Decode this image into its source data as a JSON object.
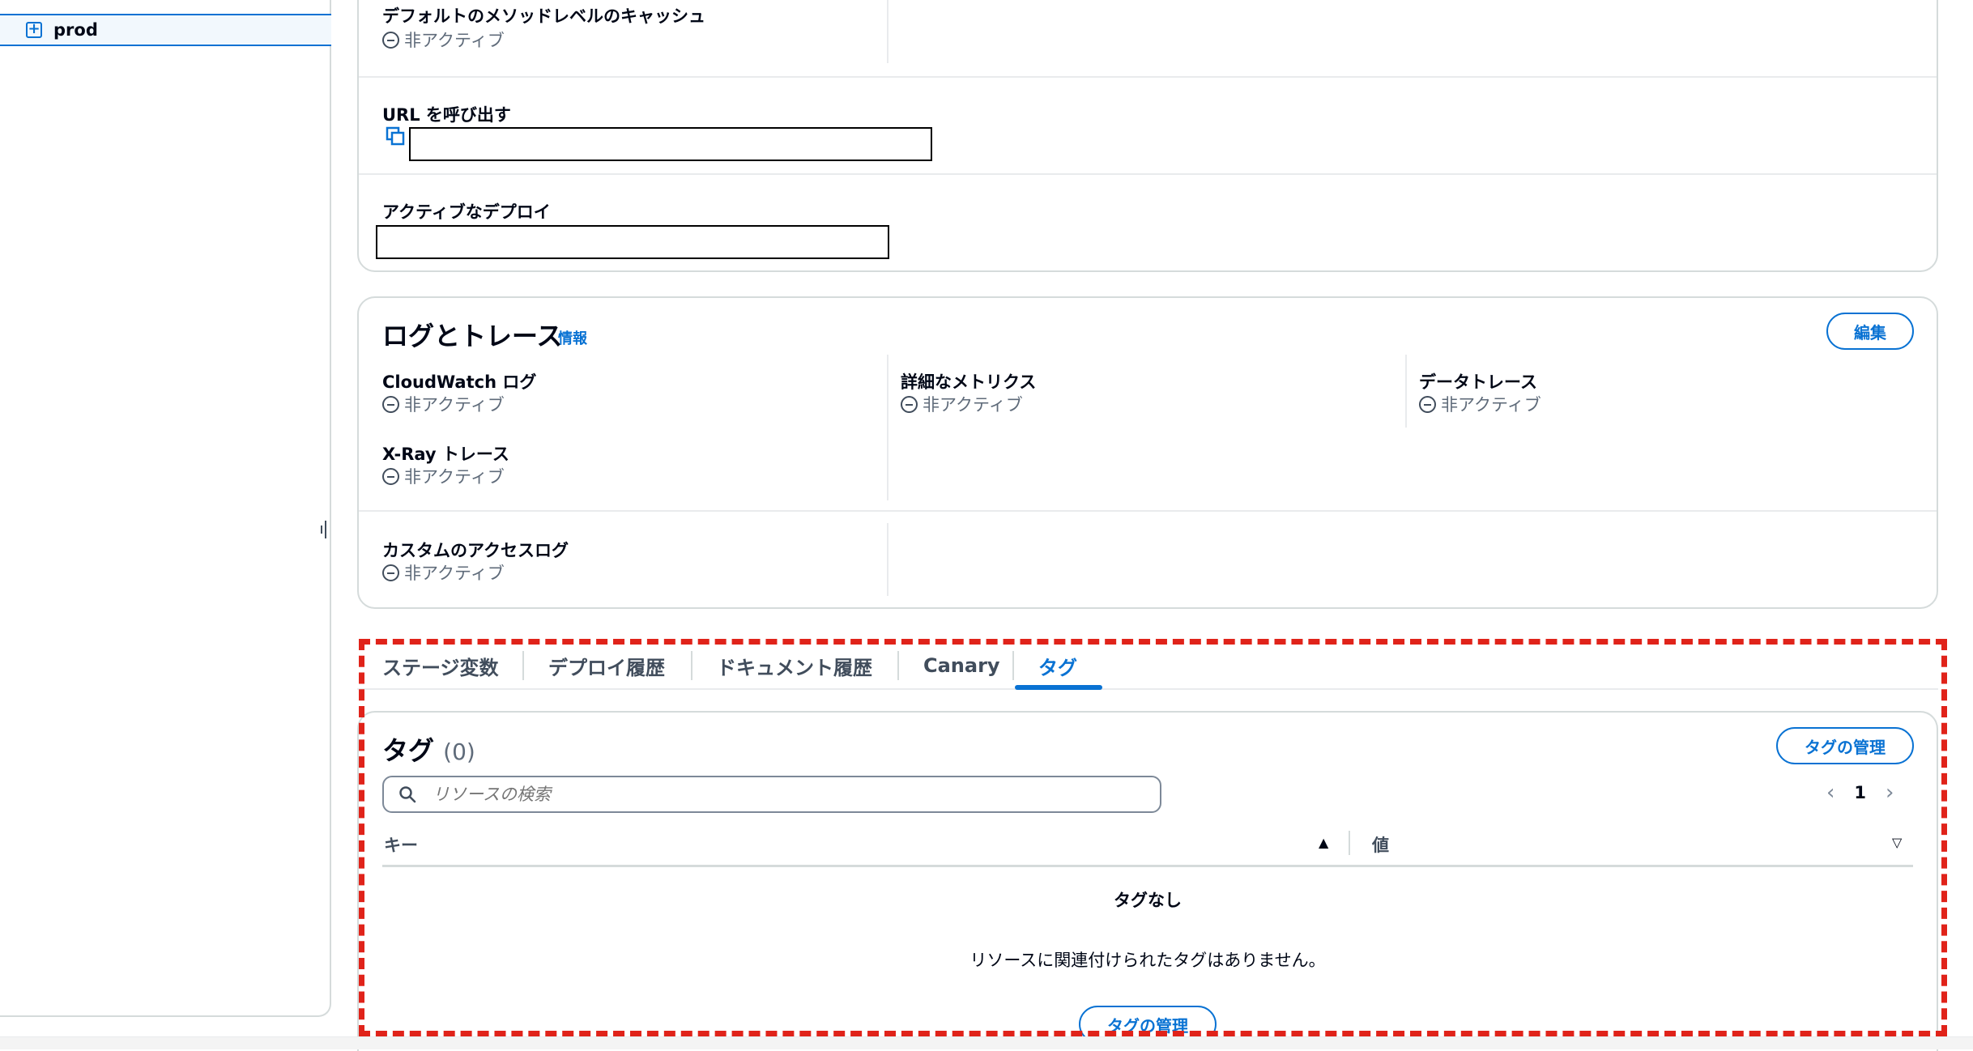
{
  "sidebar": {
    "tree_item": {
      "label": "prod",
      "toggle": "+"
    }
  },
  "stage_details": {
    "cache": {
      "label": "デフォルトのメソッドレベルのキャッシュ",
      "status": "非アクティブ"
    },
    "invoke_url": {
      "label": "URL を呼び出す"
    },
    "active_deployment": {
      "label": "アクティブなデプロイ"
    }
  },
  "logs": {
    "title": "ログとトレース",
    "info": "情報",
    "edit_label": "編集",
    "cloudwatch": {
      "label": "CloudWatch ログ",
      "status": "非アクティブ"
    },
    "metrics": {
      "label": "詳細なメトリクス",
      "status": "非アクティブ"
    },
    "datatrace": {
      "label": "データトレース",
      "status": "非アクティブ"
    },
    "xray": {
      "label": "X-Ray トレース",
      "status": "非アクティブ"
    },
    "access_log": {
      "label": "カスタムのアクセスログ",
      "status": "非アクティブ"
    }
  },
  "tabs": [
    {
      "label": "ステージ変数"
    },
    {
      "label": "デプロイ履歴"
    },
    {
      "label": "ドキュメント履歴"
    },
    {
      "label": "Canary"
    },
    {
      "label": "タグ"
    }
  ],
  "tags": {
    "title": "タグ",
    "count": "(0)",
    "manage_label": "タグの管理",
    "search_placeholder": "リソースの検索",
    "page": "1",
    "columns": {
      "key": "キー",
      "value": "値"
    },
    "empty_title": "タグなし",
    "empty_desc": "リソースに関連付けられたタグはありません。",
    "empty_button": "タグの管理"
  },
  "colors": {
    "accent": "#0972d3",
    "highlight": "#e0231a"
  }
}
